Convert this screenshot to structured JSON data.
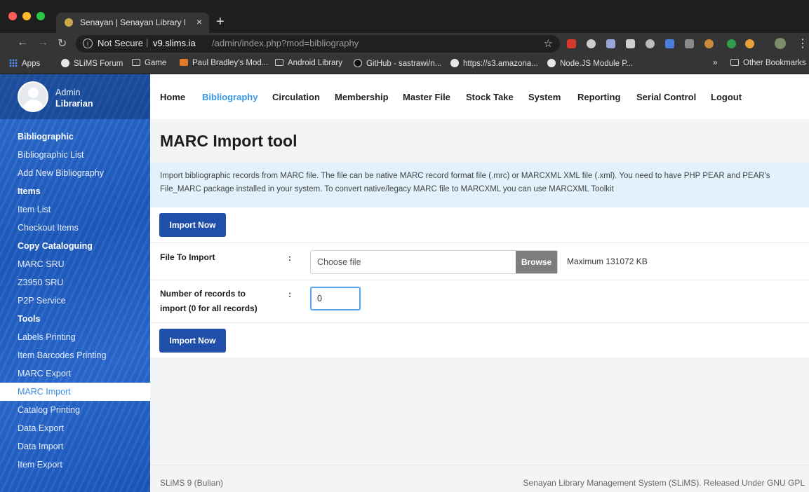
{
  "browser": {
    "tab_title": "Senayan | Senayan Library Mana",
    "security_label": "Not Secure",
    "url_host": "v9.slims.ia",
    "url_path": "/admin/index.php?mod=bibliography",
    "bookmarks": [
      "Apps",
      "SLiMS Forum",
      "Game",
      "Paul Bradley's Mod...",
      "Android Library",
      "GitHub - sastrawi/n...",
      "https://s3.amazona...",
      "Node.JS Module P..."
    ],
    "bookmarks_overflow": "»",
    "other_bookmarks": "Other Bookmarks"
  },
  "profile": {
    "name": "Admin",
    "role": "Librarian"
  },
  "sidebar": {
    "sections": [
      {
        "heading": "Bibliographic",
        "items": [
          "Bibliographic List",
          "Add New Bibliography"
        ]
      },
      {
        "heading": "Items",
        "items": [
          "Item List",
          "Checkout Items"
        ]
      },
      {
        "heading": "Copy Cataloguing",
        "items": [
          "MARC SRU",
          "Z3950 SRU",
          "P2P Service"
        ]
      },
      {
        "heading": "Tools",
        "items": [
          "Labels Printing",
          "Item Barcodes Printing",
          "MARC Export",
          "MARC Import",
          "Catalog Printing",
          "Data Export",
          "Data Import",
          "Item Export"
        ]
      }
    ],
    "active_item": "MARC Import"
  },
  "topnav": {
    "items": [
      "Home",
      "Bibliography",
      "Circulation",
      "Membership",
      "Master File",
      "Stock Take",
      "System",
      "Reporting",
      "Serial Control",
      "Logout"
    ],
    "active": "Bibliography"
  },
  "main": {
    "title": "MARC Import tool",
    "info": "Import bibliographic records from MARC file. The file can be native MARC record format file (.mrc) or MARCXML XML file (.xml). You need to have PHP PEAR and PEAR's File_MARC package installed in your system. To convert native/legacy MARC file to MARCXML you can use MARCXML Toolkit",
    "import_button": "Import Now",
    "file_label": "File To Import",
    "colon": ":",
    "file_placeholder": "Choose file",
    "browse_label": "Browse",
    "max_size": "Maximum 131072 KB",
    "records_label_line1": "Number of records to",
    "records_label_line2": "import (0 for all records)",
    "records_value": "0"
  },
  "footer": {
    "version": "SLiMS 9 (Bulian)",
    "credit": "Senayan Library Management System (SLiMS). Released Under GNU GPL"
  }
}
